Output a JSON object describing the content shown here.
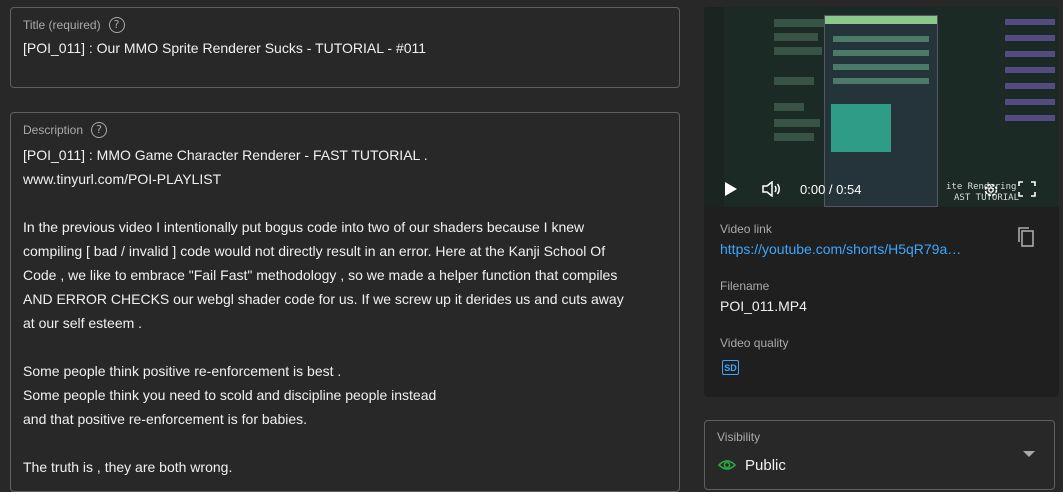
{
  "title_field": {
    "label": "Title (required)",
    "help_glyph": "?",
    "value": "[POI_011] : Our MMO Sprite Renderer Sucks - TUTORIAL - #011"
  },
  "description_field": {
    "label": "Description",
    "help_glyph": "?",
    "lines": [
      "[POI_011] : MMO Game Character Renderer - FAST TUTORIAL .",
      "www.tinyurl.com/POI-PLAYLIST",
      "",
      "In the previous video I intentionally put bogus code into two of our shaders because I knew",
      "compiling [ bad / invalid ] code would not directly result in an error. Here at the Kanji School Of",
      "Code , we like to embrace \"Fail Fast\" methodology , so we made a helper function that compiles",
      "AND ERROR CHECKS our webgl shader code for us. If we screw up it derides us and cuts away",
      "at our self esteem .",
      "",
      "Some people think positive re-enforcement is best .",
      "Some people think you need to scold and discipline people instead",
      "and that positive re-enforcement is for babies.",
      "",
      "The truth is , they are both wrong."
    ]
  },
  "player": {
    "time": "0:00 / 0:54",
    "overlay_text_1": "ite Rendering",
    "overlay_text_2": "AST TUTORIAL",
    "icons": [
      "play-icon",
      "volume-icon",
      "settings-icon",
      "fullscreen-icon"
    ]
  },
  "video_details": {
    "video_link_label": "Video link",
    "video_link_value": "https://youtube.com/shorts/H5qR79a…",
    "filename_label": "Filename",
    "filename_value": "POI_011.MP4",
    "quality_label": "Video quality",
    "quality_badge": "SD",
    "copy_icon": "copy-icon"
  },
  "visibility": {
    "label": "Visibility",
    "value": "Public",
    "icon": "eye-icon"
  },
  "colors": {
    "background": "#282828",
    "card": "#1f1f1f",
    "border": "#606060",
    "link": "#3ea6ff",
    "public_green": "#2ba640"
  }
}
